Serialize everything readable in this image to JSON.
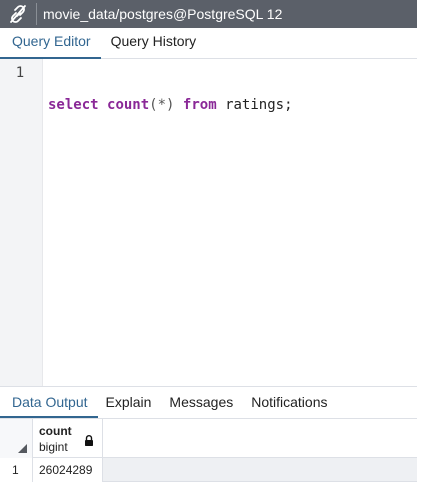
{
  "titlebar": {
    "connection_title": "movie_data/postgres@PostgreSQL 12",
    "icon": "connection-status-icon"
  },
  "editor_tabs": [
    {
      "label": "Query Editor",
      "active": true
    },
    {
      "label": "Query History",
      "active": false
    }
  ],
  "editor": {
    "line_numbers": [
      "1"
    ],
    "query_tokens": {
      "select": "select",
      "count": "count",
      "args": "(*)",
      "from": "from",
      "table": "ratings",
      "semicolon": ";"
    }
  },
  "output_tabs": [
    {
      "label": "Data Output",
      "active": true
    },
    {
      "label": "Explain",
      "active": false
    },
    {
      "label": "Messages",
      "active": false
    },
    {
      "label": "Notifications",
      "active": false
    }
  ],
  "result_grid": {
    "columns": [
      {
        "name": "count",
        "type": "bigint",
        "icon": "lock-icon"
      }
    ],
    "rows": [
      {
        "row_number": "1",
        "values": [
          "26024289"
        ]
      }
    ]
  },
  "colors": {
    "accent": "#326690",
    "keyword": "#8a2897",
    "titlebar": "#5b6069"
  }
}
